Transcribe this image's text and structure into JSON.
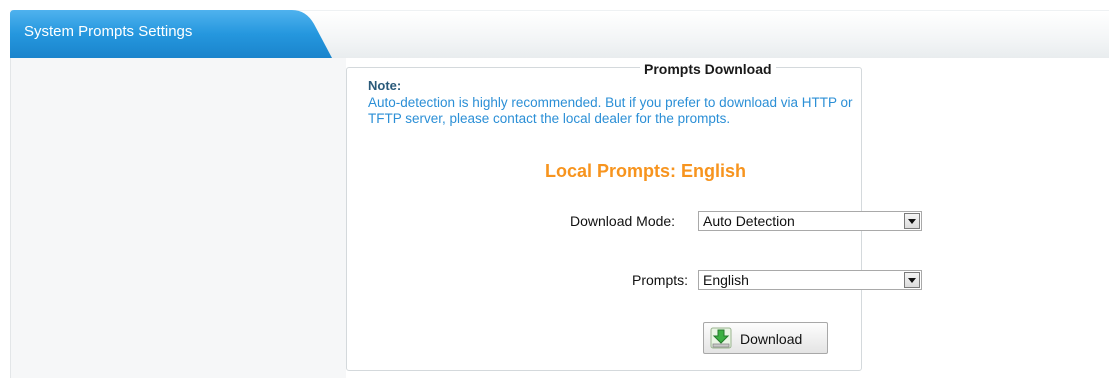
{
  "header": {
    "tab_title": "System Prompts Settings"
  },
  "panel": {
    "legend": "Prompts Download",
    "note_title": "Note:",
    "note_text": "Auto-detection is highly recommended. But if you prefer to download via HTTP or TFTP server, please contact the local dealer for the prompts.",
    "local_prompts": "Local Prompts: English"
  },
  "form": {
    "download_mode": {
      "label": "Download Mode:",
      "value": "Auto Detection"
    },
    "prompts": {
      "label": "Prompts:",
      "value": "English"
    },
    "download_button": {
      "label": "Download"
    }
  },
  "colors": {
    "tab_blue": "#1f8fd8",
    "note_blue": "#2b8fd6",
    "accent_orange": "#f7941e",
    "icon_green": "#3cb043"
  },
  "icons": {
    "download": "download-icon"
  }
}
